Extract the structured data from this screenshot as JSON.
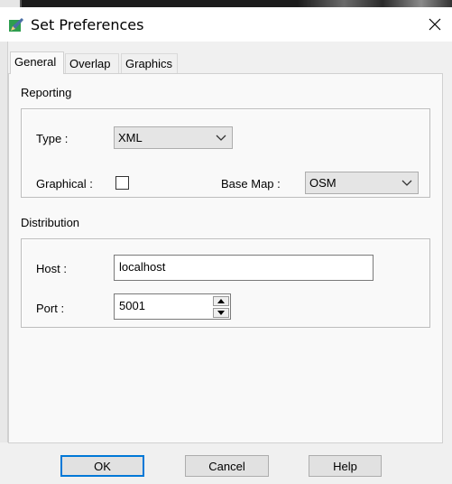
{
  "window": {
    "title": "Set Preferences"
  },
  "tabs": [
    {
      "label": "General",
      "active": true
    },
    {
      "label": "Overlap",
      "active": false
    },
    {
      "label": "Graphics",
      "active": false
    }
  ],
  "reporting": {
    "section_label": "Reporting",
    "type_label": "Type :",
    "type_value": "XML",
    "graphical_label": "Graphical :",
    "graphical_checked": false,
    "basemap_label": "Base Map :",
    "basemap_value": "OSM"
  },
  "distribution": {
    "section_label": "Distribution",
    "host_label": "Host :",
    "host_value": "localhost",
    "port_label": "Port :",
    "port_value": "5001"
  },
  "buttons": {
    "ok": "OK",
    "cancel": "Cancel",
    "help": "Help"
  },
  "colors": {
    "accent": "#0078d7",
    "dialog_bg": "#f0f0f0",
    "icon_green": "#2e9e4f"
  }
}
